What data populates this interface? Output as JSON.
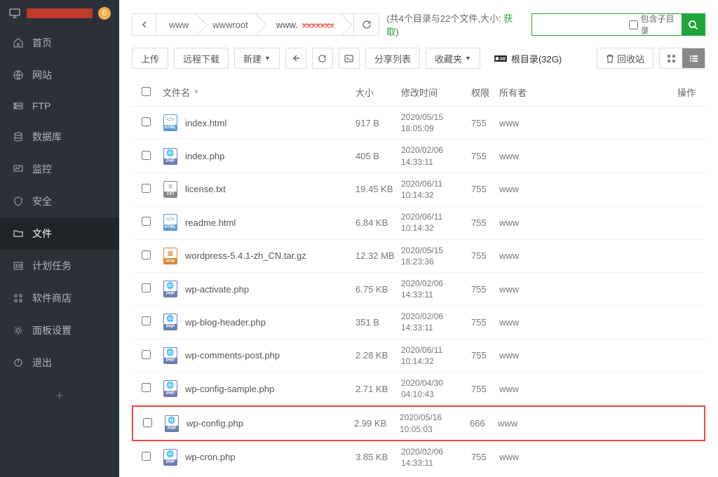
{
  "sidebar": {
    "badge": "0",
    "items": [
      {
        "icon": "home",
        "label": "首页"
      },
      {
        "icon": "globe",
        "label": "网站"
      },
      {
        "icon": "ftp",
        "label": "FTP"
      },
      {
        "icon": "database",
        "label": "数据库"
      },
      {
        "icon": "monitor",
        "label": "监控"
      },
      {
        "icon": "shield",
        "label": "安全"
      },
      {
        "icon": "folder",
        "label": "文件",
        "active": true
      },
      {
        "icon": "tasks",
        "label": "计划任务"
      },
      {
        "icon": "store",
        "label": "软件商店"
      },
      {
        "icon": "gear",
        "label": "面板设置"
      },
      {
        "icon": "power",
        "label": "退出"
      }
    ]
  },
  "breadcrumbs": [
    "www",
    "wwwroot",
    "www."
  ],
  "info": {
    "prefix": "(共4个目录与22个文件,大小: ",
    "link": "获取",
    "suffix": ")"
  },
  "search": {
    "placeholder": "",
    "sub_label": "包含子目录"
  },
  "toolbar": {
    "upload": "上传",
    "remote": "远程下载",
    "new": "新建",
    "share": "分享列表",
    "fav": "收藏夹",
    "root": "根目录(32G)",
    "trash": "回收站"
  },
  "columns": {
    "name": "文件名",
    "size": "大小",
    "date": "修改时间",
    "perm": "权限",
    "own": "所有者",
    "op": "操作"
  },
  "files": [
    {
      "icon": "html",
      "name": "index.html",
      "size": "917 B",
      "d1": "2020/05/15",
      "d2": "18:05:09",
      "perm": "755",
      "own": "www"
    },
    {
      "icon": "php",
      "name": "index.php",
      "size": "405 B",
      "d1": "2020/02/06",
      "d2": "14:33:11",
      "perm": "755",
      "own": "www"
    },
    {
      "icon": "txt",
      "name": "license.txt",
      "size": "19.45 KB",
      "d1": "2020/06/11",
      "d2": "10:14:32",
      "perm": "755",
      "own": "www"
    },
    {
      "icon": "html",
      "name": "readme.html",
      "size": "6.84 KB",
      "d1": "2020/06/11",
      "d2": "10:14:32",
      "perm": "755",
      "own": "www"
    },
    {
      "icon": "gz",
      "name": "wordpress-5.4.1-zh_CN.tar.gz",
      "size": "12.32 MB",
      "d1": "2020/05/15",
      "d2": "18:23:36",
      "perm": "755",
      "own": "www"
    },
    {
      "icon": "php",
      "name": "wp-activate.php",
      "size": "6.75 KB",
      "d1": "2020/02/06",
      "d2": "14:33:11",
      "perm": "755",
      "own": "www"
    },
    {
      "icon": "php",
      "name": "wp-blog-header.php",
      "size": "351 B",
      "d1": "2020/02/06",
      "d2": "14:33:11",
      "perm": "755",
      "own": "www"
    },
    {
      "icon": "php",
      "name": "wp-comments-post.php",
      "size": "2.28 KB",
      "d1": "2020/06/11",
      "d2": "10:14:32",
      "perm": "755",
      "own": "www"
    },
    {
      "icon": "php",
      "name": "wp-config-sample.php",
      "size": "2.71 KB",
      "d1": "2020/04/30",
      "d2": "04:10:43",
      "perm": "755",
      "own": "www"
    },
    {
      "icon": "php",
      "name": "wp-config.php",
      "size": "2.99 KB",
      "d1": "2020/05/16",
      "d2": "10:05:03",
      "perm": "666",
      "own": "www",
      "hl": true
    },
    {
      "icon": "php",
      "name": "wp-cron.php",
      "size": "3.85 KB",
      "d1": "2020/02/06",
      "d2": "14:33:11",
      "perm": "755",
      "own": "www"
    }
  ]
}
